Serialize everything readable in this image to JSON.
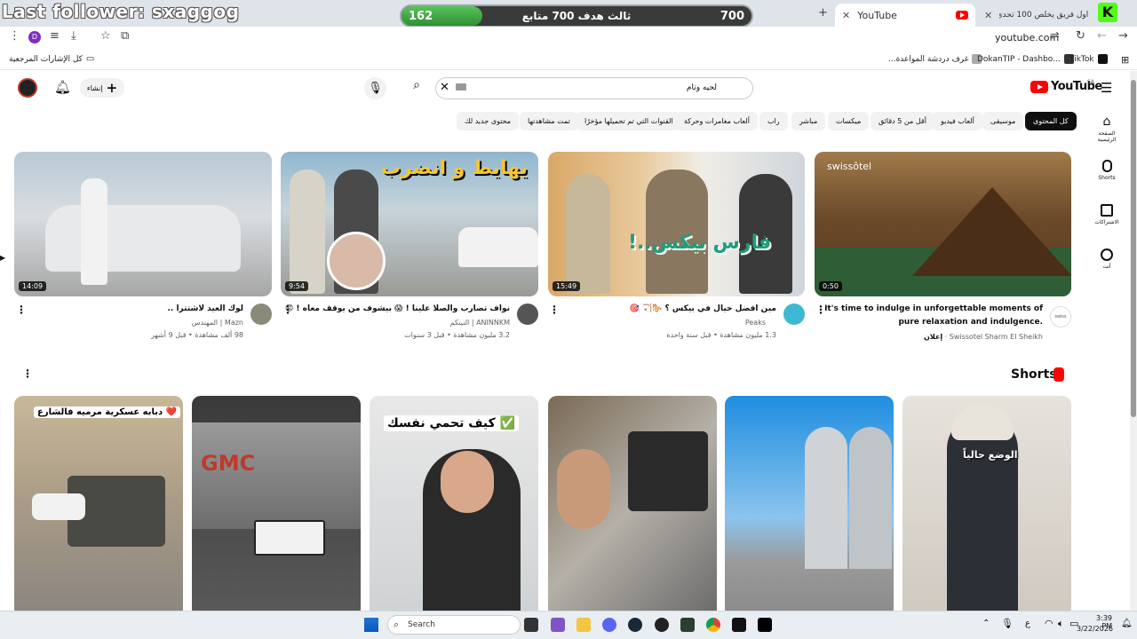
{
  "browser": {
    "tabs": [
      {
        "title": "YouTube",
        "active": true
      },
      {
        "title": "أول فريق يخلص 100 تحدي يفوز",
        "active": false
      }
    ],
    "url": "youtube.com",
    "bookmarks": [
      {
        "label": "كل الإشارات المرجعية"
      },
      {
        "label": "غرف دردشة المواعدة..."
      },
      {
        "label": "DokanTIP - Dashbo..."
      },
      {
        "label": "TikTok"
      }
    ]
  },
  "stream_overlay": {
    "last_follower": "Last follower: sxaggog",
    "goal_current": "162",
    "goal_text": "ثالث هدف 700 متابع",
    "goal_target": "700",
    "goal_progress": 0.23
  },
  "youtube": {
    "logo_text": "YouTube",
    "region": "SA",
    "create_label": "إنشاء",
    "search_query": "لحيه وتام",
    "chips": [
      {
        "label": "كل المحتوى",
        "selected": true
      },
      {
        "label": "موسيقى"
      },
      {
        "label": "ألعاب فيديو"
      },
      {
        "label": "أقل من 5 دقائق"
      },
      {
        "label": "ميكسات"
      },
      {
        "label": "مباشر"
      },
      {
        "label": "راب"
      },
      {
        "label": "ألعاب مغامرات وحركة"
      },
      {
        "label": "القنوات التي تم تحميلها مؤخرًا"
      },
      {
        "label": "تمت مشاهدتها"
      },
      {
        "label": "محتوى جديد لك"
      }
    ],
    "nav": [
      {
        "label": "الصفحة الرئيسية",
        "icon": "home-icon"
      },
      {
        "label": "Shorts",
        "icon": "shorts-icon"
      },
      {
        "label": "الاشتراكات",
        "icon": "subscriptions-icon"
      },
      {
        "label": "أنت",
        "icon": "you-icon"
      }
    ],
    "videos": [
      {
        "title": "It's time to indulge in unforgettable moments of",
        "title2": "pure relaxation and indulgence.",
        "channel": "Swissotel Sharm El Sheikh",
        "meta": "إعلان",
        "duration": "0:50",
        "brand": "swissôtel"
      },
      {
        "title": "مين افضل خيال في بيكس ؟ 🐎🏹 🎯",
        "channel": "Peaks",
        "meta": "1.3 مليون مشاهدة • قبل سنة واحدة",
        "duration": "15:49"
      },
      {
        "title": "نواف تضارب والصلا علينا ! 😱 بيشوف من يوقف معاه ! 😡",
        "channel": "ANINNKM | النينكم",
        "meta": "3.2 مليون مشاهدة • قبل 3 سنوات",
        "duration": "9:54"
      },
      {
        "title": "لوك العيد لاشتترا ..",
        "channel": "Mazn | المهندس",
        "meta": "98 ألف مشاهدة • قبل 9 أشهر",
        "duration": "14:09"
      }
    ],
    "thumb_texts": {
      "v2_overlay": "فارس بيكس..!",
      "v3_overlay": "يهايط و انضرب"
    },
    "shorts_title": "Shorts",
    "shorts": [
      {
        "caption": "الوضع حالياً"
      },
      {
        "caption": ""
      },
      {
        "caption": ""
      },
      {
        "caption": "كيف تحمي نفسك ✅"
      },
      {
        "caption": "GMC"
      },
      {
        "caption": "دبابه عسكرية مرميه فالشارع ❤️"
      }
    ]
  },
  "taskbar": {
    "search_label": "Search",
    "time": "3:39 PM",
    "date": "3/22/2026",
    "lang": "ع"
  }
}
